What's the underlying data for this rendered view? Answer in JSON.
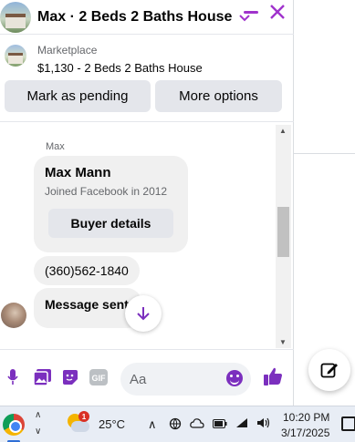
{
  "header": {
    "title": "Max · 2 Beds 2 Baths House",
    "chevron_icon": "chevron-down-icon",
    "minimize_icon": "minimize-icon",
    "close_icon": "close-icon"
  },
  "listing": {
    "label": "Marketplace",
    "title": "$1,130 - 2 Beds 2 Baths House",
    "buttons": {
      "mark_pending": "Mark as pending",
      "more_options": "More options"
    }
  },
  "messages": {
    "sender": "Max",
    "profile_card": {
      "name": "Max Mann",
      "subtitle": "Joined Facebook in 2012",
      "button": "Buyer details"
    },
    "phone": "(360)562-1840",
    "last_message": "Message sent"
  },
  "composer": {
    "placeholder": "Aa",
    "icons": [
      "microphone-icon",
      "photo-icon",
      "sticker-icon",
      "gif-icon",
      "emoji-icon",
      "like-icon"
    ],
    "gif_label": "GIF"
  },
  "new_message_icon": "compose-icon",
  "taskbar": {
    "weather_badge": "1",
    "temperature": "25°C",
    "tray_icons": [
      "chevron-up-icon",
      "network-icon",
      "onedrive-icon",
      "battery-icon",
      "wifi-icon",
      "volume-icon"
    ],
    "time": "10:20 PM",
    "date": "3/17/2025"
  },
  "colors": {
    "accent": "#7b2fbe",
    "header_icons": "#a033cc",
    "bubble": "#f0f0f0",
    "button_bg": "#e4e6eb"
  }
}
